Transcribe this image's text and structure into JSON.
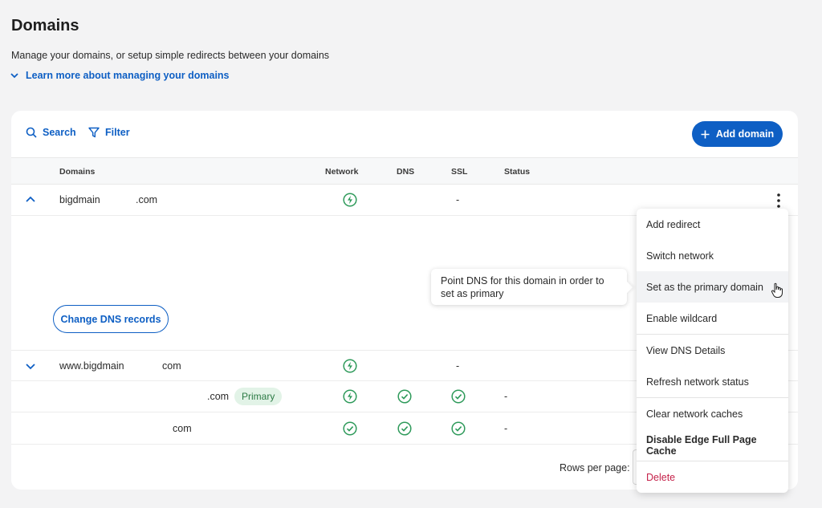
{
  "page": {
    "title": "Domains",
    "description": "Manage your domains, or setup simple redirects between your domains",
    "learn_more": "Learn more about managing your domains"
  },
  "toolbar": {
    "search": "Search",
    "filter": "Filter",
    "add_domain": "Add domain"
  },
  "table": {
    "headers": {
      "domains": "Domains",
      "network": "Network",
      "dns": "DNS",
      "ssl": "SSL",
      "status": "Status"
    },
    "rows": [
      {
        "domain_a": "bigdmain",
        "domain_b": ".com",
        "ssl": "-",
        "expanded": true
      },
      {
        "domain_a": "www.bigdmain",
        "domain_b": "com",
        "ssl": "-",
        "expanded": false
      },
      {
        "domain": ".com",
        "badge": "Primary",
        "status": "-"
      },
      {
        "domain": "com",
        "status": "-"
      }
    ]
  },
  "expanded": {
    "change_dns_button": "Change DNS records"
  },
  "tooltip": {
    "text": "Point DNS for this domain in order to set as primary"
  },
  "footer": {
    "rows_per_page": "Rows per page:"
  },
  "menu": {
    "items": [
      "Add redirect",
      "Switch network",
      "Set as the primary domain",
      "Enable wildcard",
      "View DNS Details",
      "Refresh network status",
      "Clear network caches",
      "Disable Edge Full Page Cache",
      "Delete"
    ]
  },
  "colors": {
    "accent": "#0e5fc4",
    "success": "#2e9a5a",
    "danger": "#c5224a",
    "badge_bg": "#e2f3e7"
  },
  "icons": [
    "chevron-down-icon",
    "search-icon",
    "filter-icon",
    "plus-icon",
    "chevron-up-icon",
    "lightning-icon",
    "check-circle-icon",
    "kebab-menu-icon",
    "hand-cursor-icon"
  ]
}
